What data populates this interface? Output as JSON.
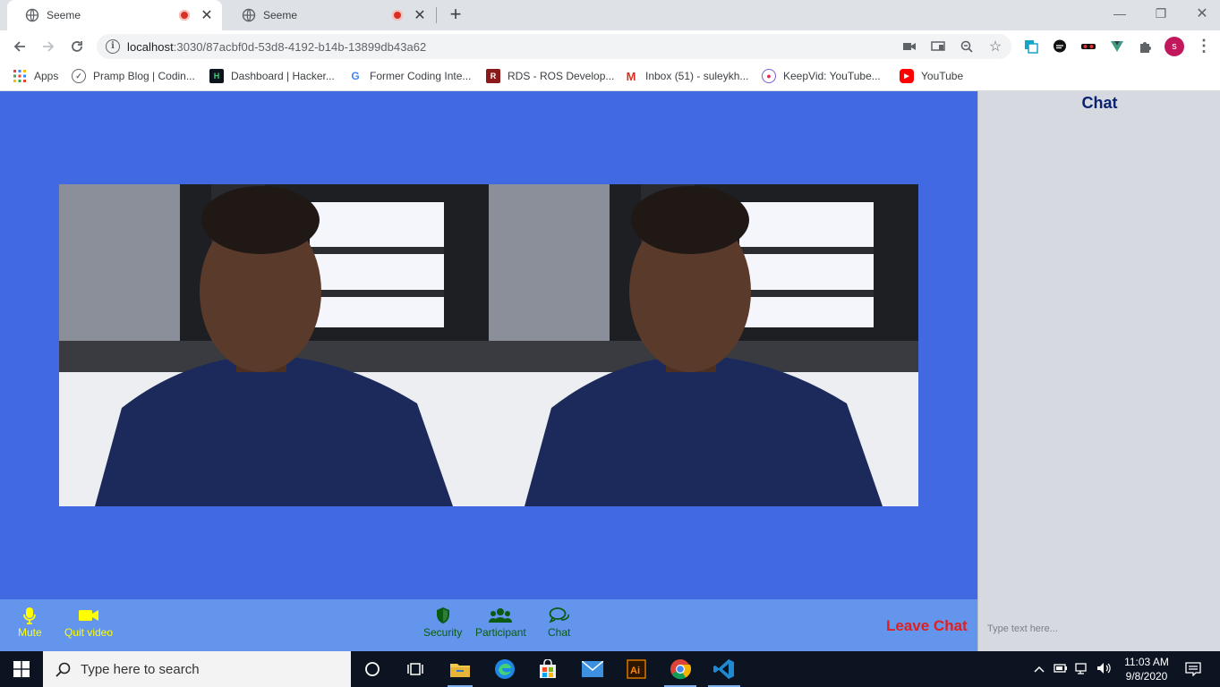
{
  "browser": {
    "tabs": [
      {
        "title": "Seeme",
        "active": true
      },
      {
        "title": "Seeme",
        "active": false
      }
    ],
    "url_host": "localhost",
    "url_path": ":3030/87acbf0d-53d8-4192-b14b-13899db43a62",
    "profile_initial": "s",
    "bookmarks": [
      {
        "label": "Apps",
        "icon": "apps-grid-icon"
      },
      {
        "label": "Pramp Blog | Codin...",
        "icon": "pramp-icon"
      },
      {
        "label": "Dashboard | Hacker...",
        "icon": "hackerrank-icon"
      },
      {
        "label": "Former Coding Inte...",
        "icon": "google-icon"
      },
      {
        "label": "RDS - ROS Develop...",
        "icon": "rds-icon"
      },
      {
        "label": "Inbox (51) - suleykh...",
        "icon": "gmail-icon"
      },
      {
        "label": "KeepVid: YouTube...",
        "icon": "keepvid-icon"
      },
      {
        "label": "YouTube",
        "icon": "youtube-icon"
      }
    ]
  },
  "app": {
    "colors": {
      "stage": "#4169e1",
      "controls": "#6495ed",
      "chat_bg": "#d6dae0",
      "leave": "#e0201f",
      "accent_yellow": "#ffff00",
      "accent_green": "#0b5a12"
    },
    "controls_left": [
      {
        "label": "Mute",
        "icon": "microphone-icon"
      },
      {
        "label": "Quit video",
        "icon": "video-camera-icon"
      }
    ],
    "controls_center": [
      {
        "label": "Security",
        "icon": "shield-icon"
      },
      {
        "label": "Participant",
        "icon": "users-icon"
      },
      {
        "label": "Chat",
        "icon": "chat-bubbles-icon"
      }
    ],
    "leave_label": "Leave Chat",
    "chat": {
      "title": "Chat",
      "input_placeholder": "Type text here..."
    }
  },
  "taskbar": {
    "search_placeholder": "Type here to search",
    "time": "11:03 AM",
    "date": "9/8/2020",
    "apps": [
      "cortana-icon",
      "task-view-icon",
      "file-explorer-icon",
      "edge-icon",
      "store-icon",
      "mail-icon",
      "illustrator-icon",
      "chrome-icon",
      "vscode-icon"
    ]
  }
}
